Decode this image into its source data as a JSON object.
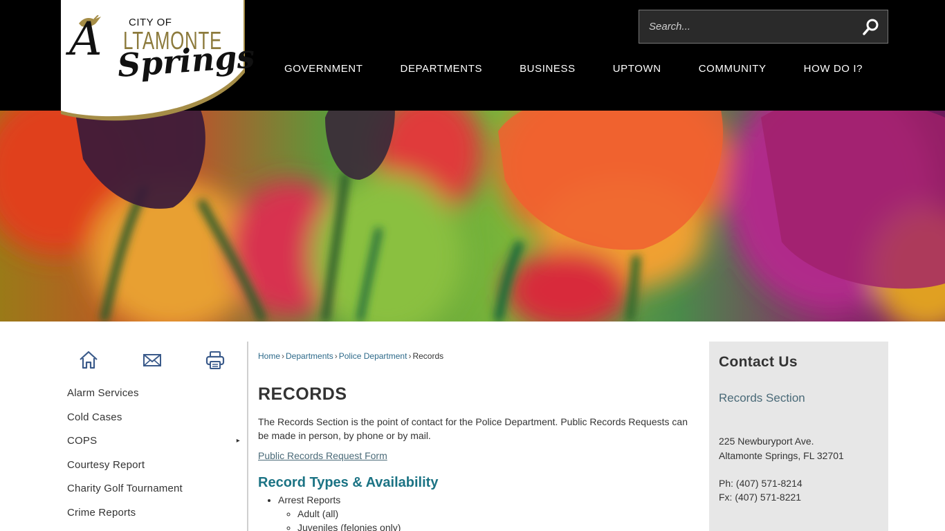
{
  "logo": {
    "line1": "CITY OF",
    "line2": "LTAMONTE",
    "initial": "A",
    "line3": "Springs"
  },
  "search": {
    "placeholder": "Search..."
  },
  "nav": {
    "items": [
      {
        "label": "GOVERNMENT"
      },
      {
        "label": "DEPARTMENTS"
      },
      {
        "label": "BUSINESS"
      },
      {
        "label": "UPTOWN"
      },
      {
        "label": "COMMUNITY"
      },
      {
        "label": "HOW DO I?"
      }
    ]
  },
  "tools": {
    "icons": [
      "home-icon",
      "email-icon",
      "print-icon"
    ]
  },
  "sidebar": {
    "items": [
      {
        "label": "Alarm Services"
      },
      {
        "label": "Cold Cases"
      },
      {
        "label": "COPS",
        "arrow": "▸"
      },
      {
        "label": "Courtesy Report"
      },
      {
        "label": "Charity Golf Tournament"
      },
      {
        "label": "Crime Reports"
      }
    ]
  },
  "breadcrumb": {
    "items": [
      "Home",
      "Departments",
      "Police Department"
    ],
    "current": "Records",
    "separator": "›"
  },
  "main": {
    "title": "RECORDS",
    "intro": "The Records Section is the point of contact for the Police Department. Public Records Requests can be made in person, by phone or by mail.",
    "request_link": "Public Records Request Form",
    "section_heading": "Record Types & Availability",
    "records": {
      "item1": "Arrest Reports",
      "sub1": "Adult (all)",
      "sub2": "Juveniles (felonies only)"
    }
  },
  "contact": {
    "title": "Contact Us",
    "section": "Records Section",
    "address_line1": "225 Newburyport Ave.",
    "address_line2": "Altamonte Springs, FL 32701",
    "phone": "Ph: (407) 571-8214",
    "fax": "Fx: (407) 571-8221"
  },
  "colors": {
    "header_bg": "#000000",
    "accent_teal": "#1b7384",
    "link_blue": "#2e6a8a",
    "panel_bg": "#e7e7e7",
    "logo_gold": "#8c7a3c"
  }
}
